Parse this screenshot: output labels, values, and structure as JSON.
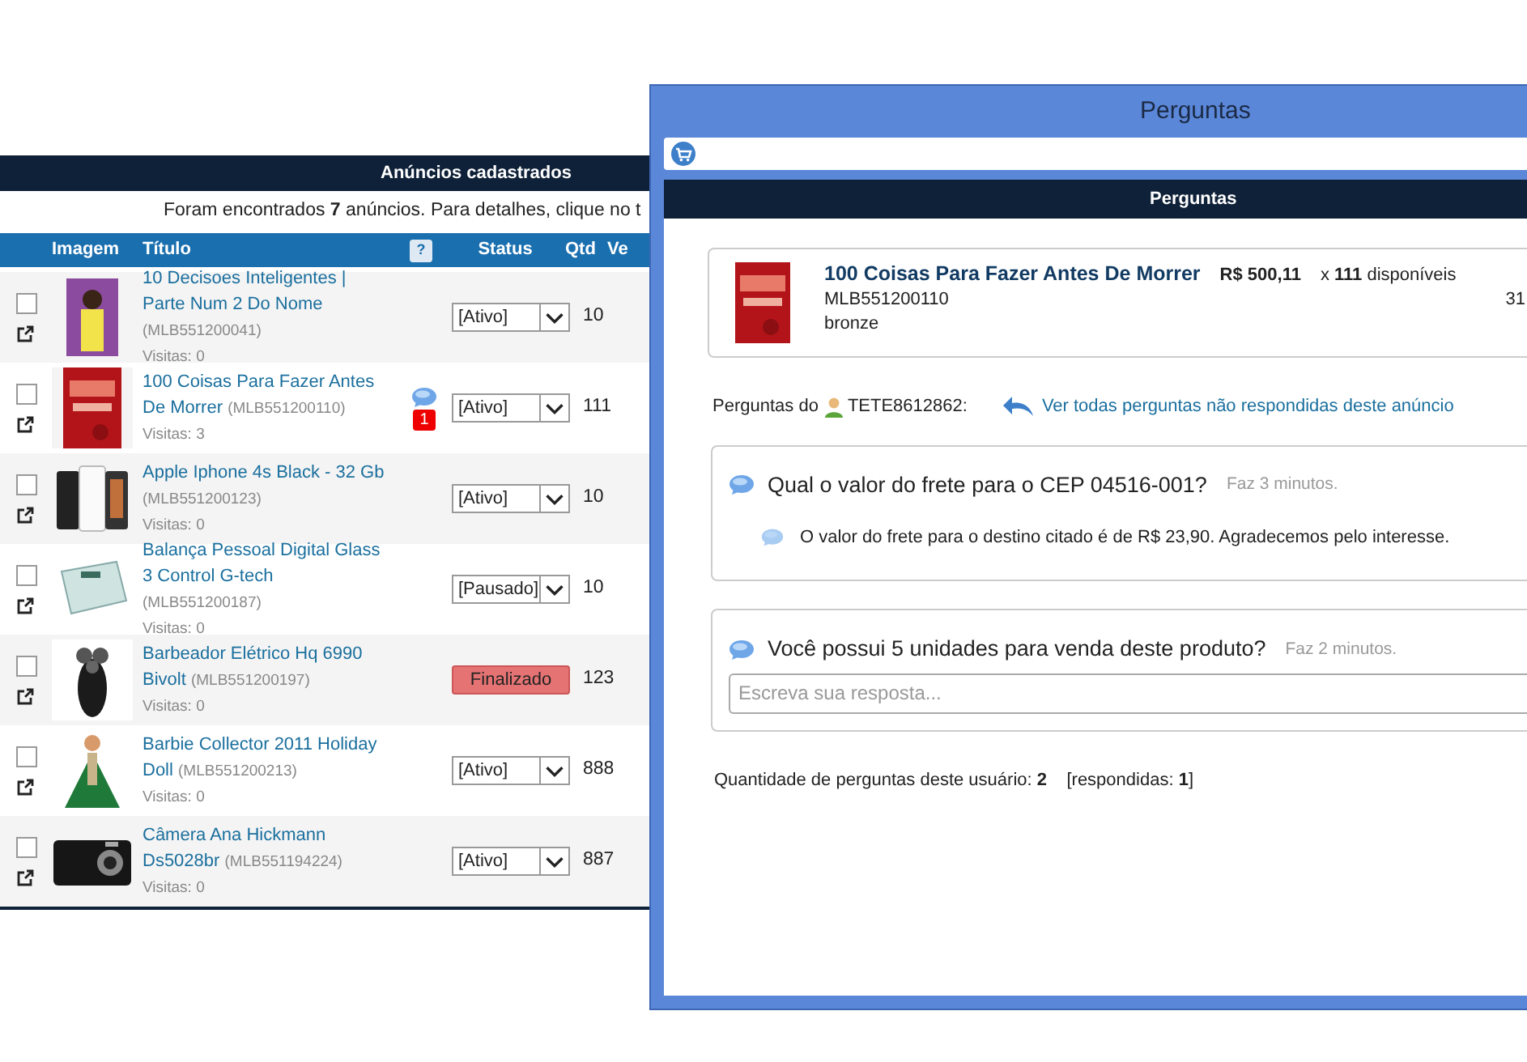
{
  "listings": {
    "title": "Anúncios cadastrados",
    "summary": "Foram encontrados **7** anúncios. Para detalhes, clique no t",
    "columns": [
      "Imagem",
      "Título",
      "?",
      "Status",
      "Qtd",
      "Ve"
    ],
    "rows": [
      {
        "checked": false,
        "title": "10 Decisoes Inteligentes | Parte Num 2 Do Nome",
        "code": "(MLB551200041)",
        "visits": "Visitas: 0",
        "status": {
          "kind": "select",
          "value": "[Ativo]"
        },
        "qty": "10"
      },
      {
        "checked": false,
        "title": "100 Coisas Para Fazer Antes De Morrer",
        "code": "(MLB551200110)",
        "visits": "Visitas: 3",
        "new_questions": "1",
        "status": {
          "kind": "select",
          "value": "[Ativo]"
        },
        "qty": "111"
      },
      {
        "checked": false,
        "title": "Apple Iphone 4s Black - 32 Gb",
        "code": "(MLB551200123)",
        "visits": "Visitas: 0",
        "status": {
          "kind": "select",
          "value": "[Ativo]"
        },
        "qty": "10"
      },
      {
        "checked": false,
        "title": "Balança Pessoal Digital Glass 3 Control G-tech",
        "code": "(MLB551200187)",
        "visits": "Visitas: 0",
        "status": {
          "kind": "select",
          "value": "[Pausado]"
        },
        "qty": "10"
      },
      {
        "checked": false,
        "title": "Barbeador Elétrico Hq 6990 Bivolt",
        "code": "(MLB551200197)",
        "visits": "Visitas: 0",
        "status": {
          "kind": "badge",
          "value": "Finalizado"
        },
        "qty": "123"
      },
      {
        "checked": false,
        "title": "Barbie Collector 2011 Holiday Doll",
        "code": "(MLB551200213)",
        "visits": "Visitas: 0",
        "status": {
          "kind": "select",
          "value": "[Ativo]"
        },
        "qty": "888"
      },
      {
        "checked": false,
        "title": "Câmera Ana Hickmann Ds5028br",
        "code": "(MLB551194224)",
        "visits": "Visitas: 0",
        "status": {
          "kind": "select",
          "value": "[Ativo]"
        },
        "qty": "887"
      }
    ]
  },
  "window": {
    "title": "Perguntas",
    "header": "Perguntas",
    "product": {
      "title": "100 Coisas Para Fazer Antes De Morrer",
      "price": "R$ 500,11",
      "stock": "x **111** disponíveis",
      "code": "MLB551200110",
      "level": "bronze",
      "column_3": "31"
    },
    "asker": {
      "label": "Perguntas do",
      "user": "TETE8612862:",
      "link": "Ver todas perguntas não respondidas deste anúncio"
    },
    "questions": [
      {
        "text": "Qual o valor do frete para o CEP 04516-001?",
        "time": "Faz 3 minutos.",
        "answer": "O valor do frete para o destino citado é de R$ 23,90. Agradecemos pelo interesse."
      },
      {
        "text": "Você possui 5 unidades para venda deste produto?",
        "time": "Faz 2 minutos.",
        "reply_placeholder": "Escreva sua resposta..."
      }
    ],
    "footer": "Quantidade de perguntas deste usuário: **2**    [respondidas: **1**]"
  }
}
